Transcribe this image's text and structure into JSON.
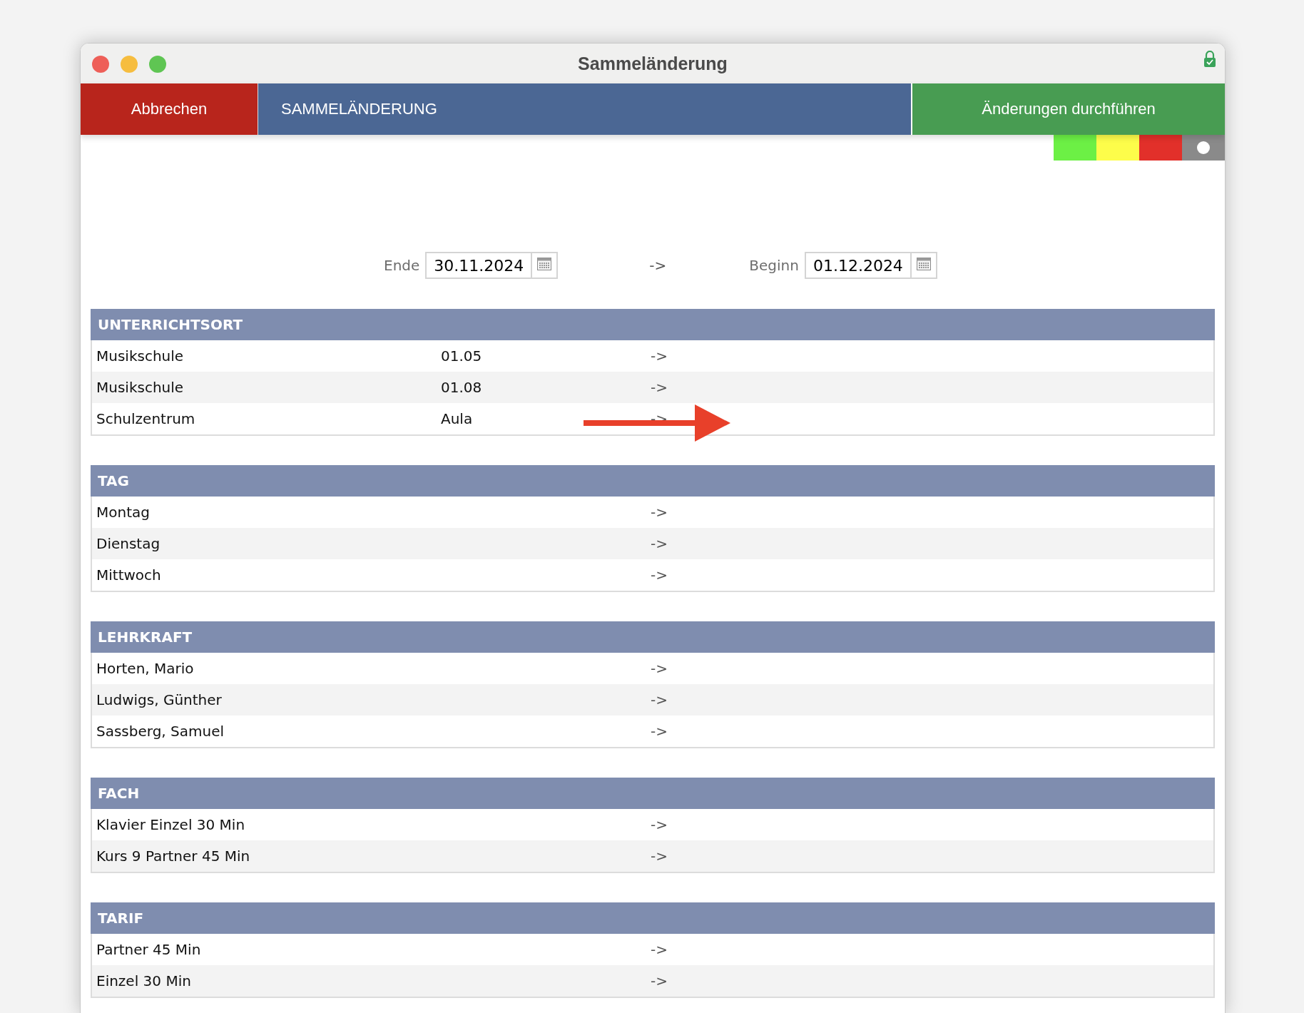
{
  "window": {
    "title": "Sammeländerung"
  },
  "toolbar": {
    "cancel": "Abbrechen",
    "heading": "SAMMELÄNDERUNG",
    "apply": "Änderungen durchführen"
  },
  "swatches": [
    {
      "color": "#6cf045",
      "kind": "plain"
    },
    {
      "color": "#fdfd4a",
      "kind": "plain"
    },
    {
      "color": "#e2302a",
      "kind": "plain"
    },
    {
      "color": "#8a8a8a",
      "kind": "dot"
    }
  ],
  "dates": {
    "end_label": "Ende",
    "end": "30.11.2024",
    "arrow": "->",
    "begin_label": "Beginn",
    "begin": "01.12.2024"
  },
  "sections": [
    {
      "title": "UNTERRICHTSORT",
      "rows": [
        {
          "cells": [
            "Musikschule",
            "01.05"
          ],
          "arrow": "->",
          "marked": false
        },
        {
          "cells": [
            "Musikschule",
            "01.08"
          ],
          "arrow": "->",
          "marked": false
        },
        {
          "cells": [
            "Schulzentrum",
            "Aula"
          ],
          "arrow": "->",
          "marked": true
        }
      ]
    },
    {
      "title": "TAG",
      "rows": [
        {
          "cells": [
            "Montag"
          ],
          "arrow": "->",
          "marked": false
        },
        {
          "cells": [
            "Dienstag"
          ],
          "arrow": "->",
          "marked": false
        },
        {
          "cells": [
            "Mittwoch"
          ],
          "arrow": "->",
          "marked": false
        }
      ]
    },
    {
      "title": "LEHRKRAFT",
      "rows": [
        {
          "cells": [
            "Horten, Mario"
          ],
          "arrow": "->",
          "marked": false
        },
        {
          "cells": [
            "Ludwigs, Günther"
          ],
          "arrow": "->",
          "marked": false
        },
        {
          "cells": [
            "Sassberg, Samuel"
          ],
          "arrow": "->",
          "marked": false
        }
      ]
    },
    {
      "title": "FACH",
      "rows": [
        {
          "cells": [
            "Klavier Einzel 30 Min"
          ],
          "arrow": "->",
          "marked": false
        },
        {
          "cells": [
            "Kurs 9 Partner 45 Min"
          ],
          "arrow": "->",
          "marked": false
        }
      ]
    },
    {
      "title": "TARIF",
      "rows": [
        {
          "cells": [
            "Partner 45 Min"
          ],
          "arrow": "->",
          "marked": false
        },
        {
          "cells": [
            "Einzel 30 Min"
          ],
          "arrow": "->",
          "marked": false
        }
      ]
    }
  ]
}
